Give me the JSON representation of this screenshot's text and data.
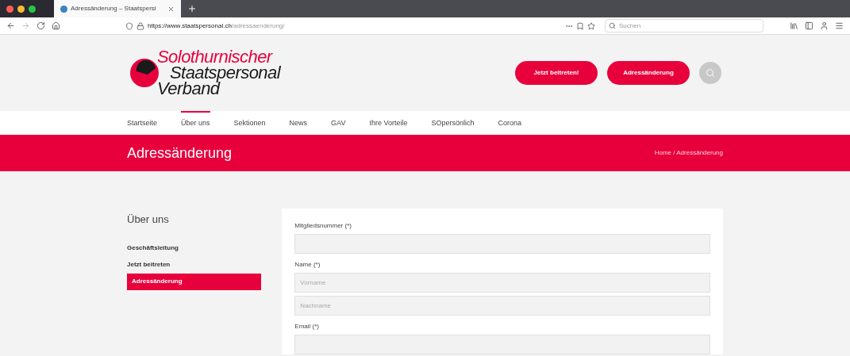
{
  "browser": {
    "tab_title": "Adressänderung – Staatspersi",
    "url_host": "https://www.staatspersonal.ch",
    "url_path": "/adressaenderung/",
    "search_placeholder": "Suchen"
  },
  "logo": {
    "line_1": "Solothurnischer",
    "line_2": "Staatspersonal",
    "line_3": "Verband"
  },
  "header_buttons": [
    "Jetzt beitreten!",
    "Adressänderung"
  ],
  "nav": [
    {
      "label": "Startseite",
      "selected": false
    },
    {
      "label": "Über uns",
      "selected": true
    },
    {
      "label": "Sektionen",
      "selected": false
    },
    {
      "label": "News",
      "selected": false
    },
    {
      "label": "GAV",
      "selected": false
    },
    {
      "label": "Ihre Vorteile",
      "selected": false
    },
    {
      "label": "SOpersönlich",
      "selected": false
    },
    {
      "label": "Corona",
      "selected": false
    }
  ],
  "page_title": "Adressänderung",
  "breadcrumb": "Home / Adressänderung",
  "sidebar": {
    "title": "Über uns",
    "items": [
      {
        "label": "Geschäftsleitung",
        "selected": false
      },
      {
        "label": "Jetzt beitreten",
        "selected": false
      },
      {
        "label": "Adressänderung",
        "selected": true
      }
    ]
  },
  "form": [
    {
      "label": "Mitgliedsnummer (*)",
      "kind": "single"
    },
    {
      "label": "Name (*)",
      "kind": "multi",
      "placeholders": [
        "Vorname",
        "Nachname"
      ]
    },
    {
      "label": "Email (*)",
      "kind": "single"
    }
  ]
}
